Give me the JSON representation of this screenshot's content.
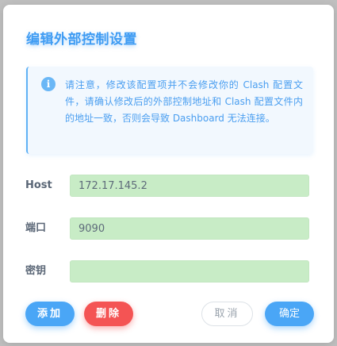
{
  "dialog": {
    "title": "编辑外部控制设置",
    "notice": {
      "icon": "info-icon",
      "icon_glyph": "i",
      "text": "请注意，修改该配置项并不会修改你的 Clash 配置文件，请确认修改后的外部控制地址和 Clash 配置文件内的地址一致，否则会导致 Dashboard 无法连接。"
    },
    "fields": {
      "host": {
        "label": "Host",
        "value": "172.17.145.2",
        "placeholder": ""
      },
      "port": {
        "label": "端口",
        "value": "9090",
        "placeholder": ""
      },
      "secret": {
        "label": "密钥",
        "value": "",
        "placeholder": ""
      }
    },
    "buttons": {
      "add": "添加",
      "delete": "删除",
      "cancel": "取消",
      "confirm": "确定"
    }
  },
  "colors": {
    "accent": "#4aa6f6",
    "title": "#3f9cf3",
    "danger": "#f45454",
    "input_bg": "#c8ecc6",
    "notice_bg": "#f2f8fe"
  }
}
